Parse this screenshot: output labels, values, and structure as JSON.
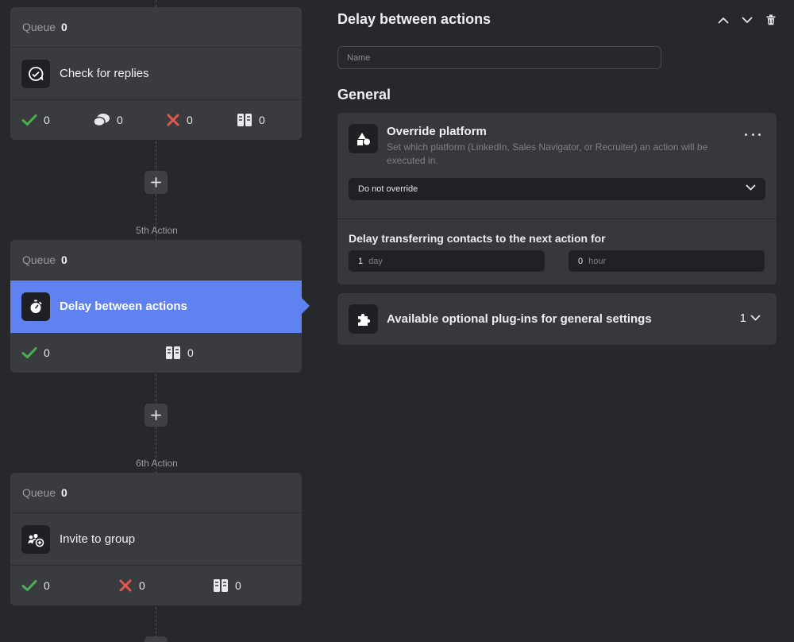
{
  "flow": {
    "cards": [
      {
        "queue_label": "Queue",
        "queue_count": "0",
        "action_label": "Check for replies",
        "action_icon": "replies-icon",
        "stats": [
          {
            "icon": "check-icon",
            "value": "0"
          },
          {
            "icon": "speech-bubbles-icon",
            "value": "0"
          },
          {
            "icon": "x-icon",
            "value": "0"
          },
          {
            "icon": "skipped-icon",
            "value": "0"
          }
        ]
      },
      {
        "step_label": "5th Action",
        "queue_label": "Queue",
        "queue_count": "0",
        "action_label": "Delay between actions",
        "action_icon": "stopwatch-icon",
        "stats": [
          {
            "icon": "check-icon",
            "value": "0"
          },
          {
            "icon": "skipped-icon",
            "value": "0"
          }
        ]
      },
      {
        "step_label": "6th Action",
        "queue_label": "Queue",
        "queue_count": "0",
        "action_label": "Invite to group",
        "action_icon": "group-invite-icon",
        "stats": [
          {
            "icon": "check-icon",
            "value": "0"
          },
          {
            "icon": "x-icon",
            "value": "0"
          },
          {
            "icon": "skipped-icon",
            "value": "0"
          }
        ]
      }
    ]
  },
  "panel": {
    "title": "Delay between actions",
    "name_placeholder": "Name",
    "section_title": "General",
    "override": {
      "title": "Override platform",
      "description": "Set which platform (LinkedIn, Sales Navigator, or Recruiter) an action will be executed in.",
      "select_value": "Do not override"
    },
    "delay": {
      "label": "Delay transferring contacts to the next action for",
      "days_value": "1",
      "days_unit": "day",
      "hours_value": "0",
      "hours_unit": "hour"
    },
    "plugins": {
      "label": "Available optional plug-ins for general settings",
      "count": "1"
    }
  },
  "colors": {
    "background": "#27282c",
    "card": "#3a3b3f",
    "active_action": "#5f82f0",
    "success": "#4caf50",
    "error": "#e2574c"
  }
}
